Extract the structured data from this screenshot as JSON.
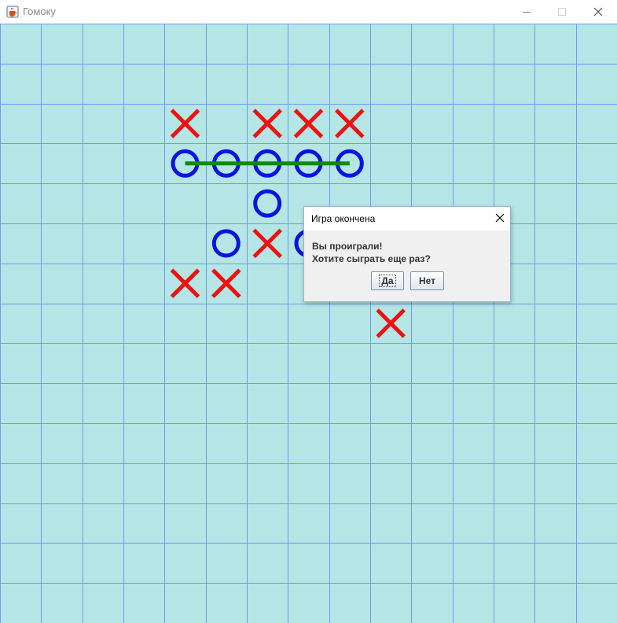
{
  "window": {
    "title": "Гомоку",
    "app_icon": "java-cup-icon",
    "controls": [
      "minimize-icon",
      "maximize-icon",
      "close-icon"
    ]
  },
  "board": {
    "columns": 15,
    "rows": 15,
    "background_color": "#b5e5e4",
    "grid_color": "#6a9ff0",
    "x_color": "#ee1111",
    "o_color": "#0a14dd",
    "win_line_color": "#118811",
    "pieces": [
      {
        "mark": "X",
        "col": 4,
        "row": 2
      },
      {
        "mark": "X",
        "col": 6,
        "row": 2
      },
      {
        "mark": "X",
        "col": 7,
        "row": 2
      },
      {
        "mark": "X",
        "col": 8,
        "row": 2
      },
      {
        "mark": "O",
        "col": 4,
        "row": 3
      },
      {
        "mark": "O",
        "col": 5,
        "row": 3
      },
      {
        "mark": "O",
        "col": 6,
        "row": 3
      },
      {
        "mark": "O",
        "col": 7,
        "row": 3
      },
      {
        "mark": "O",
        "col": 8,
        "row": 3
      },
      {
        "mark": "O",
        "col": 6,
        "row": 4
      },
      {
        "mark": "O",
        "col": 5,
        "row": 5
      },
      {
        "mark": "X",
        "col": 6,
        "row": 5
      },
      {
        "mark": "O",
        "col": 7,
        "row": 5
      },
      {
        "mark": "X",
        "col": 4,
        "row": 6
      },
      {
        "mark": "X",
        "col": 5,
        "row": 6
      },
      {
        "mark": "X",
        "col": 9,
        "row": 7
      }
    ],
    "winning_line": {
      "from": {
        "col": 4,
        "row": 3
      },
      "to": {
        "col": 8,
        "row": 3
      }
    }
  },
  "dialog": {
    "title": "Игра окончена",
    "message_line1": "Вы проиграли!",
    "message_line2": "Хотите сыграть еще раз?",
    "yes_label": "Да",
    "no_label": "Нет",
    "focused_button": "yes"
  }
}
